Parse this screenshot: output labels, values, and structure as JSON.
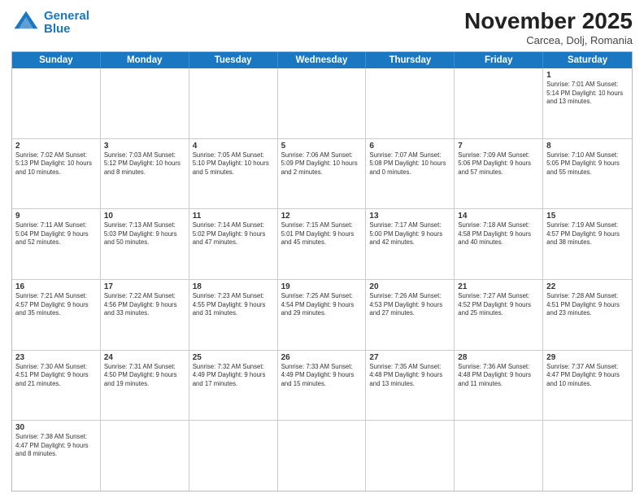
{
  "header": {
    "logo_line1": "General",
    "logo_line2": "Blue",
    "title": "November 2025",
    "subtitle": "Carcea, Dolj, Romania"
  },
  "days_of_week": [
    "Sunday",
    "Monday",
    "Tuesday",
    "Wednesday",
    "Thursday",
    "Friday",
    "Saturday"
  ],
  "weeks": [
    [
      {
        "day": "",
        "info": ""
      },
      {
        "day": "",
        "info": ""
      },
      {
        "day": "",
        "info": ""
      },
      {
        "day": "",
        "info": ""
      },
      {
        "day": "",
        "info": ""
      },
      {
        "day": "",
        "info": ""
      },
      {
        "day": "1",
        "info": "Sunrise: 7:01 AM\nSunset: 5:14 PM\nDaylight: 10 hours and 13 minutes."
      }
    ],
    [
      {
        "day": "2",
        "info": "Sunrise: 7:02 AM\nSunset: 5:13 PM\nDaylight: 10 hours and 10 minutes."
      },
      {
        "day": "3",
        "info": "Sunrise: 7:03 AM\nSunset: 5:12 PM\nDaylight: 10 hours and 8 minutes."
      },
      {
        "day": "4",
        "info": "Sunrise: 7:05 AM\nSunset: 5:10 PM\nDaylight: 10 hours and 5 minutes."
      },
      {
        "day": "5",
        "info": "Sunrise: 7:06 AM\nSunset: 5:09 PM\nDaylight: 10 hours and 2 minutes."
      },
      {
        "day": "6",
        "info": "Sunrise: 7:07 AM\nSunset: 5:08 PM\nDaylight: 10 hours and 0 minutes."
      },
      {
        "day": "7",
        "info": "Sunrise: 7:09 AM\nSunset: 5:06 PM\nDaylight: 9 hours and 57 minutes."
      },
      {
        "day": "8",
        "info": "Sunrise: 7:10 AM\nSunset: 5:05 PM\nDaylight: 9 hours and 55 minutes."
      }
    ],
    [
      {
        "day": "9",
        "info": "Sunrise: 7:11 AM\nSunset: 5:04 PM\nDaylight: 9 hours and 52 minutes."
      },
      {
        "day": "10",
        "info": "Sunrise: 7:13 AM\nSunset: 5:03 PM\nDaylight: 9 hours and 50 minutes."
      },
      {
        "day": "11",
        "info": "Sunrise: 7:14 AM\nSunset: 5:02 PM\nDaylight: 9 hours and 47 minutes."
      },
      {
        "day": "12",
        "info": "Sunrise: 7:15 AM\nSunset: 5:01 PM\nDaylight: 9 hours and 45 minutes."
      },
      {
        "day": "13",
        "info": "Sunrise: 7:17 AM\nSunset: 5:00 PM\nDaylight: 9 hours and 42 minutes."
      },
      {
        "day": "14",
        "info": "Sunrise: 7:18 AM\nSunset: 4:58 PM\nDaylight: 9 hours and 40 minutes."
      },
      {
        "day": "15",
        "info": "Sunrise: 7:19 AM\nSunset: 4:57 PM\nDaylight: 9 hours and 38 minutes."
      }
    ],
    [
      {
        "day": "16",
        "info": "Sunrise: 7:21 AM\nSunset: 4:57 PM\nDaylight: 9 hours and 35 minutes."
      },
      {
        "day": "17",
        "info": "Sunrise: 7:22 AM\nSunset: 4:56 PM\nDaylight: 9 hours and 33 minutes."
      },
      {
        "day": "18",
        "info": "Sunrise: 7:23 AM\nSunset: 4:55 PM\nDaylight: 9 hours and 31 minutes."
      },
      {
        "day": "19",
        "info": "Sunrise: 7:25 AM\nSunset: 4:54 PM\nDaylight: 9 hours and 29 minutes."
      },
      {
        "day": "20",
        "info": "Sunrise: 7:26 AM\nSunset: 4:53 PM\nDaylight: 9 hours and 27 minutes."
      },
      {
        "day": "21",
        "info": "Sunrise: 7:27 AM\nSunset: 4:52 PM\nDaylight: 9 hours and 25 minutes."
      },
      {
        "day": "22",
        "info": "Sunrise: 7:28 AM\nSunset: 4:51 PM\nDaylight: 9 hours and 23 minutes."
      }
    ],
    [
      {
        "day": "23",
        "info": "Sunrise: 7:30 AM\nSunset: 4:51 PM\nDaylight: 9 hours and 21 minutes."
      },
      {
        "day": "24",
        "info": "Sunrise: 7:31 AM\nSunset: 4:50 PM\nDaylight: 9 hours and 19 minutes."
      },
      {
        "day": "25",
        "info": "Sunrise: 7:32 AM\nSunset: 4:49 PM\nDaylight: 9 hours and 17 minutes."
      },
      {
        "day": "26",
        "info": "Sunrise: 7:33 AM\nSunset: 4:49 PM\nDaylight: 9 hours and 15 minutes."
      },
      {
        "day": "27",
        "info": "Sunrise: 7:35 AM\nSunset: 4:48 PM\nDaylight: 9 hours and 13 minutes."
      },
      {
        "day": "28",
        "info": "Sunrise: 7:36 AM\nSunset: 4:48 PM\nDaylight: 9 hours and 11 minutes."
      },
      {
        "day": "29",
        "info": "Sunrise: 7:37 AM\nSunset: 4:47 PM\nDaylight: 9 hours and 10 minutes."
      }
    ],
    [
      {
        "day": "30",
        "info": "Sunrise: 7:38 AM\nSunset: 4:47 PM\nDaylight: 9 hours and 8 minutes."
      },
      {
        "day": "",
        "info": ""
      },
      {
        "day": "",
        "info": ""
      },
      {
        "day": "",
        "info": ""
      },
      {
        "day": "",
        "info": ""
      },
      {
        "day": "",
        "info": ""
      },
      {
        "day": "",
        "info": ""
      }
    ]
  ]
}
